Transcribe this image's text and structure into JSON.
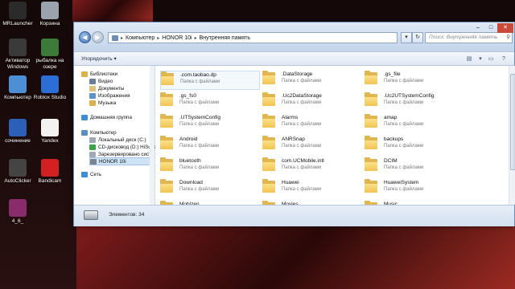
{
  "desktop": {
    "icons": [
      {
        "label": "MRLauncher",
        "icon": "mrlauncher-icon",
        "color": "#2b2b2b"
      },
      {
        "label": "Корзина",
        "icon": "recycle-bin-icon",
        "color": "#9aa3ad"
      },
      {
        "label": "Активатор Windows",
        "icon": "activator-icon",
        "color": "#3a3a3a"
      },
      {
        "label": "рыбалка на озере",
        "icon": "fishing-game-icon",
        "color": "#3c7a3a"
      },
      {
        "label": "Компьютер",
        "icon": "computer-icon",
        "color": "#4c8fd6"
      },
      {
        "label": "Roblox Studio",
        "icon": "roblox-studio-icon",
        "color": "#2b6fd6"
      },
      {
        "label": "сочинение",
        "icon": "word-document-icon",
        "color": "#2b5fb8"
      },
      {
        "label": "Yandex",
        "icon": "yandex-browser-icon",
        "color": "#f2f2f2"
      },
      {
        "label": "AutoClicker",
        "icon": "mouse-icon",
        "color": "#444"
      },
      {
        "label": "Bandicam",
        "icon": "bandicam-icon",
        "color": "#d32020"
      },
      {
        "label": "4_6_",
        "icon": "winrar-archive-icon",
        "color": "#8a2c6c"
      }
    ]
  },
  "window": {
    "address": {
      "segments": [
        "Компьютер",
        "HONOR 10i",
        "Внутренняя память"
      ]
    },
    "search_placeholder": "Поиск: Внутренняя память",
    "toolbar": {
      "organize_label": "Упорядочить ▾"
    },
    "nav": {
      "items": [
        {
          "label": "Библиотеки",
          "icon": "libraries-icon",
          "color": "#d9b24c"
        },
        {
          "label": "Видео",
          "icon": "video-library-icon",
          "color": "#6b7f99"
        },
        {
          "label": "Документы",
          "icon": "documents-library-icon",
          "color": "#d9c27a"
        },
        {
          "label": "Изображения",
          "icon": "pictures-library-icon",
          "color": "#5d93c9"
        },
        {
          "label": "Музыка",
          "icon": "music-library-icon",
          "color": "#d9b24c"
        },
        {
          "label": "Домашняя группа",
          "icon": "homegroup-icon",
          "color": "#3b8fd6"
        },
        {
          "label": "Компьютер",
          "icon": "computer-icon",
          "color": "#5b8fc2"
        },
        {
          "label": "Локальный диск (C:)",
          "icon": "local-disk-icon",
          "color": "#a0a8b2"
        },
        {
          "label": "CD-дисковод (D:) HiSuite",
          "icon": "cd-drive-icon",
          "color": "#3aa547"
        },
        {
          "label": "Зарезервировано систе",
          "icon": "reserved-disk-icon",
          "color": "#a0a8b2"
        },
        {
          "label": "HONOR 10i",
          "icon": "phone-device-icon",
          "color": "#7b8591"
        },
        {
          "label": "Сеть",
          "icon": "network-icon",
          "color": "#3b8fd6"
        }
      ]
    },
    "folders": [
      {
        "name": ".com.taobao.dp",
        "sub": "Папка с файлами"
      },
      {
        "name": ".DataStorage",
        "sub": "Папка с файлами"
      },
      {
        "name": ".gs_file",
        "sub": "Папка с файлами"
      },
      {
        "name": ".gs_fs0",
        "sub": "Папка с файлами"
      },
      {
        "name": ".Uc2DataStorage",
        "sub": "Папка с файлами"
      },
      {
        "name": ".Uc2UTSystemConfig",
        "sub": "Папка с файлами"
      },
      {
        "name": ".UTSystemConfig",
        "sub": "Папка с файлами"
      },
      {
        "name": "Alarms",
        "sub": "Папка с файлами"
      },
      {
        "name": "amap",
        "sub": "Папка с файлами"
      },
      {
        "name": "Android",
        "sub": "Папка с файлами"
      },
      {
        "name": "ANRSnap",
        "sub": "Папка с файлами"
      },
      {
        "name": "backups",
        "sub": "Папка с файлами"
      },
      {
        "name": "bluetooth",
        "sub": "Папка с файлами"
      },
      {
        "name": "com.UCMobile.intl",
        "sub": "Папка с файлами"
      },
      {
        "name": "DCIM",
        "sub": "Папка с файлами"
      },
      {
        "name": "Download",
        "sub": "Папка с файлами"
      },
      {
        "name": "Huawei",
        "sub": "Папка с файлами"
      },
      {
        "name": "HuaweiSystem",
        "sub": "Папка с файлами"
      },
      {
        "name": "Mobizen",
        "sub": ""
      },
      {
        "name": "Movies",
        "sub": ""
      },
      {
        "name": "Music",
        "sub": ""
      }
    ],
    "status": {
      "items_text": "Элементов: 34"
    }
  }
}
